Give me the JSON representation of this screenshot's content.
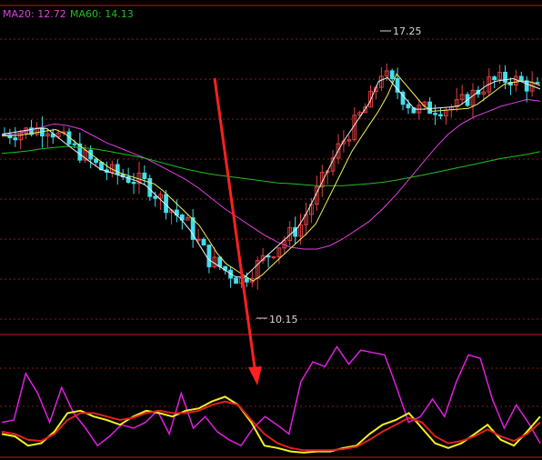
{
  "legend": {
    "ma20": {
      "label": "MA20: 12.72",
      "color": "#e040e0"
    },
    "ma60": {
      "label": "MA60: 14.13",
      "color": "#20c020"
    }
  },
  "colors": {
    "background": "#000000",
    "grid": "#8b1a1a",
    "up": "#e04040",
    "down": "#40e0f0",
    "ma5": "#f0f0f0",
    "ma10": "#f0f060",
    "ma20": "#e040e0",
    "ma60": "#20c020",
    "arrow": "#ff2020",
    "osc_purple": "#e020e0",
    "osc_yellow": "#f0f020",
    "osc_red": "#e02020"
  },
  "chart_data": [
    {
      "type": "candlestick",
      "panel": "price",
      "ylim": [
        9.0,
        18.3
      ],
      "annotations": [
        {
          "text": "17.25",
          "value": 17.25,
          "kind": "high"
        },
        {
          "text": "10.15",
          "value": 10.15,
          "kind": "low"
        }
      ],
      "series": [
        {
          "name": "MA20",
          "values": [
            14.55,
            14.6,
            14.7,
            14.8,
            14.9,
            14.85,
            14.75,
            14.55,
            14.35,
            14.2,
            14.05,
            13.9,
            13.7,
            13.5,
            13.3,
            13.05,
            12.75,
            12.45,
            12.2,
            11.95,
            11.7,
            11.5,
            11.35,
            11.3,
            11.3,
            11.4,
            11.6,
            11.85,
            12.1,
            12.45,
            12.85,
            13.3,
            13.75,
            14.2,
            14.6,
            14.9,
            15.1,
            15.25,
            15.4,
            15.5,
            15.6,
            15.55
          ]
        },
        {
          "name": "MA60",
          "values": [
            14.05,
            14.08,
            14.12,
            14.18,
            14.22,
            14.25,
            14.22,
            14.18,
            14.12,
            14.05,
            13.98,
            13.9,
            13.8,
            13.7,
            13.6,
            13.52,
            13.45,
            13.4,
            13.35,
            13.3,
            13.25,
            13.2,
            13.18,
            13.15,
            13.12,
            13.12,
            13.12,
            13.15,
            13.18,
            13.22,
            13.28,
            13.35,
            13.42,
            13.5,
            13.58,
            13.66,
            13.74,
            13.82,
            13.9,
            13.96,
            14.02,
            14.1
          ]
        }
      ]
    },
    {
      "type": "line",
      "panel": "oscillator",
      "ylim": [
        0,
        100
      ],
      "series": [
        {
          "name": "",
          "color_key": "osc_purple",
          "values": [
            30,
            32,
            72,
            55,
            30,
            60,
            38,
            25,
            10,
            18,
            28,
            25,
            30,
            40,
            20,
            55,
            25,
            35,
            22,
            15,
            10,
            25,
            35,
            28,
            20,
            65,
            82,
            78,
            95,
            80,
            92,
            90,
            88,
            60,
            30,
            35,
            50,
            35,
            65,
            88,
            85,
            50,
            25,
            45,
            30,
            12
          ]
        },
        {
          "name": "",
          "color_key": "osc_yellow",
          "values": [
            20,
            18,
            10,
            12,
            22,
            38,
            40,
            35,
            32,
            28,
            35,
            40,
            38,
            35,
            40,
            42,
            48,
            52,
            45,
            30,
            10,
            8,
            5,
            4,
            5,
            5,
            8,
            10,
            20,
            28,
            32,
            38,
            25,
            12,
            8,
            12,
            20,
            28,
            15,
            10,
            22,
            35
          ]
        },
        {
          "name": "",
          "color_key": "osc_red",
          "values": [
            22,
            20,
            15,
            14,
            20,
            32,
            38,
            38,
            35,
            32,
            34,
            38,
            40,
            38,
            38,
            40,
            45,
            48,
            45,
            32,
            20,
            12,
            8,
            6,
            6,
            6,
            7,
            9,
            15,
            22,
            28,
            34,
            30,
            18,
            12,
            14,
            18,
            24,
            18,
            14,
            20,
            30
          ]
        }
      ]
    }
  ]
}
